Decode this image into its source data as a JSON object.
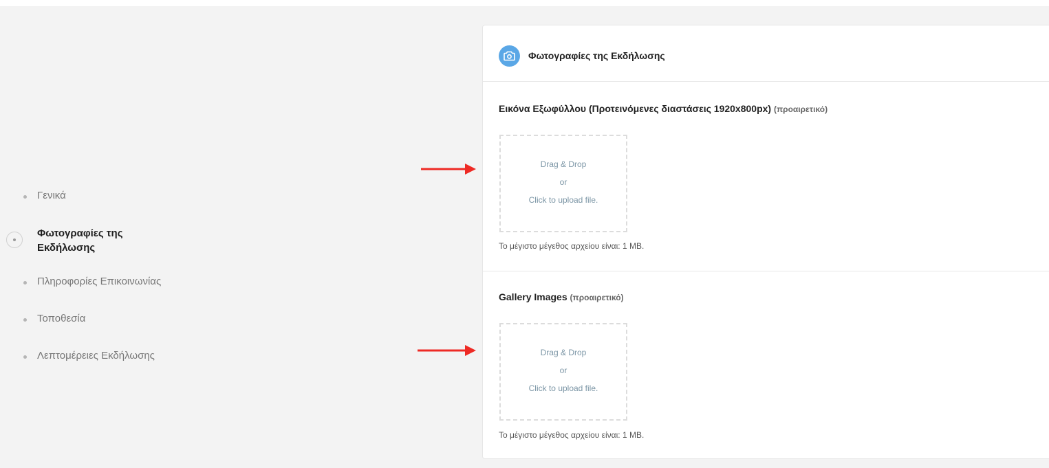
{
  "nav": {
    "items": [
      {
        "label": "Γενικά",
        "active": false
      },
      {
        "label": "Φωτογραφίες της Εκδήλωσης",
        "active": true
      },
      {
        "label": "Πληροφορίες Επικοινωνίας",
        "active": false
      },
      {
        "label": "Τοποθεσία",
        "active": false
      },
      {
        "label": "Λεπτομέρειες Εκδήλωσης",
        "active": false
      }
    ]
  },
  "card": {
    "title": "Φωτογραφίες της Εκδήλωσης",
    "icon": "camera-icon",
    "accent_color": "#5aa7e6"
  },
  "cover": {
    "label": "Εικόνα Εξωφύλλου (Προτεινόμενες διαστάσεις 1920x800px)",
    "optional": "(προαιρετικό)",
    "dropzone": {
      "line1": "Drag & Drop",
      "line2": "or",
      "line3": "Click to upload file."
    },
    "help": "Το μέγιστο μέγεθος αρχείου είναι: 1 MB."
  },
  "gallery": {
    "label": "Gallery Images",
    "optional": "(προαιρετικό)",
    "dropzone": {
      "line1": "Drag & Drop",
      "line2": "or",
      "line3": "Click to upload file."
    },
    "help": "Το μέγιστο μέγεθος αρχείου είναι: 1 MB."
  },
  "annotations": {
    "arrow_color": "#ee2a24"
  }
}
